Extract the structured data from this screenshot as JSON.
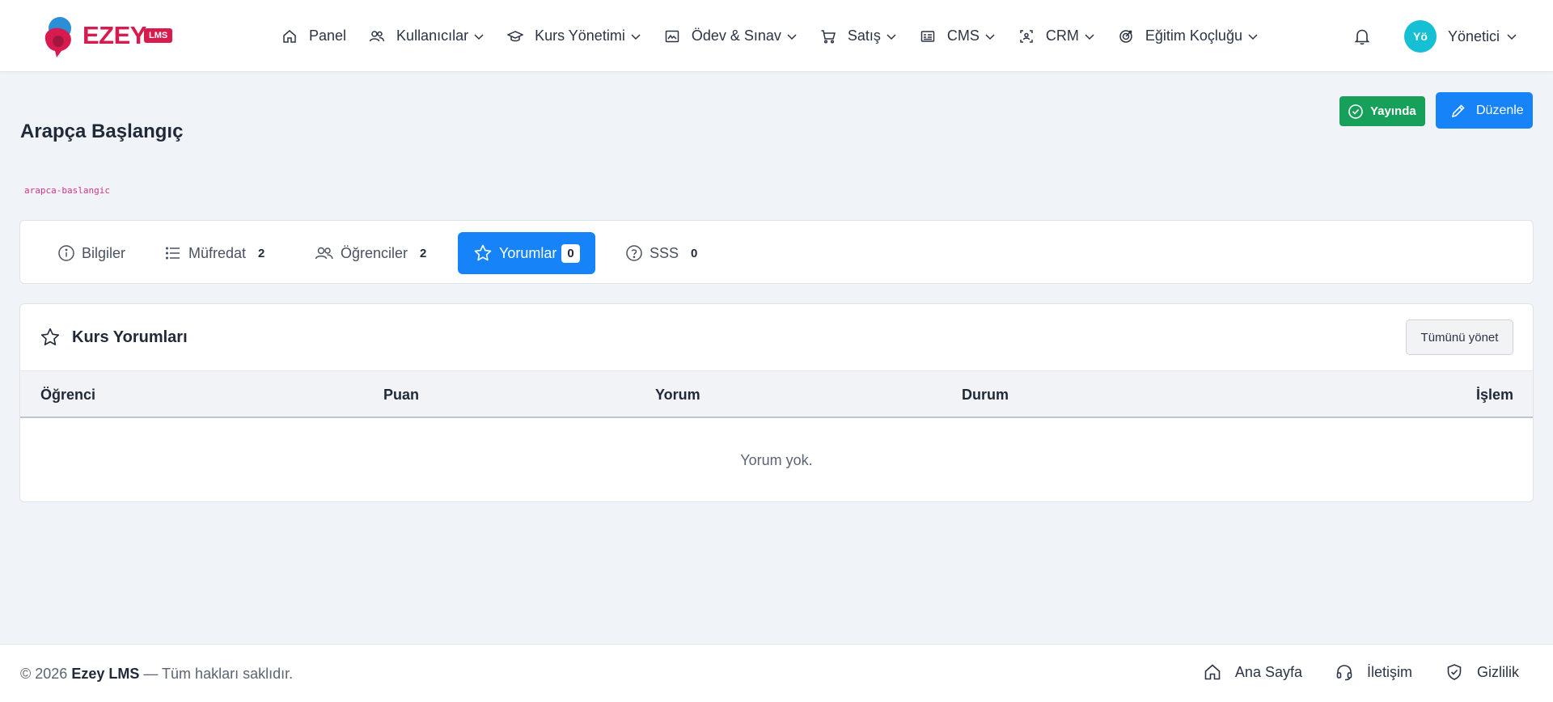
{
  "brand": {
    "name": "EZEY",
    "badge": "LMS",
    "primary_color": "#d81b4f"
  },
  "nav": {
    "items": [
      {
        "label": "Panel",
        "icon": "home-icon"
      },
      {
        "label": "Kullanıcılar",
        "icon": "users-icon"
      },
      {
        "label": "Kurs Yönetimi",
        "icon": "graduation-cap-icon"
      },
      {
        "label": "Ödev & Sınav",
        "icon": "image-icon"
      },
      {
        "label": "Satış",
        "icon": "cart-icon"
      },
      {
        "label": "CMS",
        "icon": "newspaper-icon"
      },
      {
        "label": "CRM",
        "icon": "person-scan-icon"
      },
      {
        "label": "Eğitim Koçluğu",
        "icon": "target-icon"
      }
    ],
    "user": {
      "initials": "Yö",
      "name": "Yönetici",
      "avatar_color": "#17bfd4"
    }
  },
  "course": {
    "title": "Arapça Başlangıç",
    "slug": "arapca-baslangic",
    "status_label": "Yayında",
    "status_color": "#16a05a",
    "edit_label": "Düzenle",
    "accent_color": "#1683f8"
  },
  "tabs": [
    {
      "label": "Bilgiler",
      "icon": "info-icon",
      "count": null
    },
    {
      "label": "Müfredat",
      "icon": "list-icon",
      "count": "2"
    },
    {
      "label": "Öğrenciler",
      "icon": "users-icon",
      "count": "2"
    },
    {
      "label": "Yorumlar",
      "icon": "star-icon",
      "count": "0",
      "active": true
    },
    {
      "label": "SSS",
      "icon": "question-icon",
      "count": "0"
    }
  ],
  "reviews": {
    "title": "Kurs Yorumları",
    "manage_label": "Tümünü yönet",
    "columns": [
      "Öğrenci",
      "Puan",
      "Yorum",
      "Durum",
      "İşlem"
    ],
    "rows": [],
    "empty_text": "Yorum yok."
  },
  "footer": {
    "year": "© 2026",
    "brand": "Ezey LMS",
    "rights": "— Tüm hakları saklıdır.",
    "links": [
      {
        "label": "Ana Sayfa",
        "icon": "home-icon"
      },
      {
        "label": "İletişim",
        "icon": "headset-icon"
      },
      {
        "label": "Gizlilik",
        "icon": "shield-check-icon"
      }
    ]
  }
}
